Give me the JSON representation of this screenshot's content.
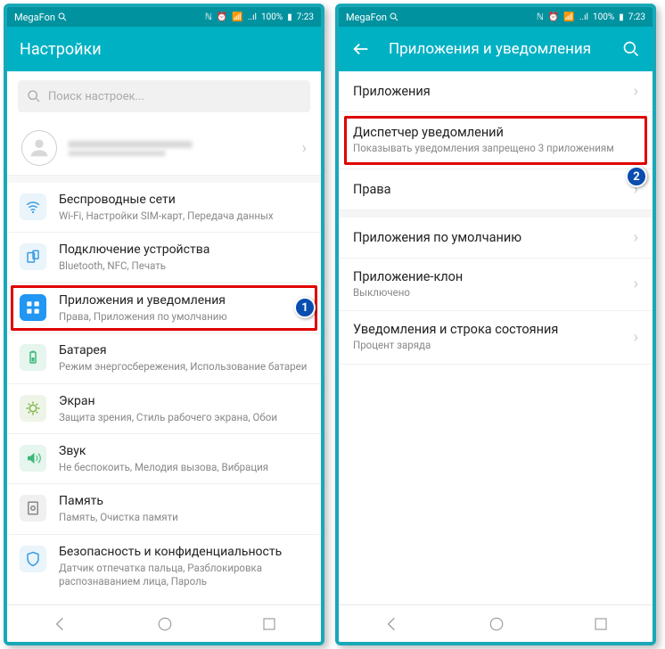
{
  "status": {
    "carrier": "MegaFon",
    "battery": "100%",
    "time": "7:23"
  },
  "phone1": {
    "title": "Настройки",
    "search_placeholder": "Поиск настроек...",
    "items": [
      {
        "title": "Беспроводные сети",
        "sub": "Wi-Fi, Настройки SIM-карт, Передача данных"
      },
      {
        "title": "Подключение устройства",
        "sub": "Bluetooth, NFC, Печать"
      },
      {
        "title": "Приложения и уведомления",
        "sub": "Права, Приложения по умолчанию"
      },
      {
        "title": "Батарея",
        "sub": "Режим энергосбережения, Использование батареи"
      },
      {
        "title": "Экран",
        "sub": "Защита зрения, Стиль рабочего экрана, Обои"
      },
      {
        "title": "Звук",
        "sub": "Не беспокоить, Мелодия вызова, Вибрация"
      },
      {
        "title": "Память",
        "sub": "Память, Очистка памяти"
      },
      {
        "title": "Безопасность и конфиденциальность",
        "sub": "Датчик отпечатка пальца, Разблокировка распознаванием лица, Пароль"
      }
    ],
    "badge": "1"
  },
  "phone2": {
    "title": "Приложения и уведомления",
    "items": [
      {
        "title": "Приложения",
        "sub": ""
      },
      {
        "title": "Диспетчер уведомлений",
        "sub": "Показывать уведомления запрещено 3 приложениям"
      },
      {
        "title": "Права",
        "sub": ""
      },
      {
        "title": "Приложения по умолчанию",
        "sub": ""
      },
      {
        "title": "Приложение-клон",
        "sub": "Выключено"
      },
      {
        "title": "Уведомления и строка состояния",
        "sub": "Процент заряда"
      }
    ],
    "badge": "2"
  }
}
